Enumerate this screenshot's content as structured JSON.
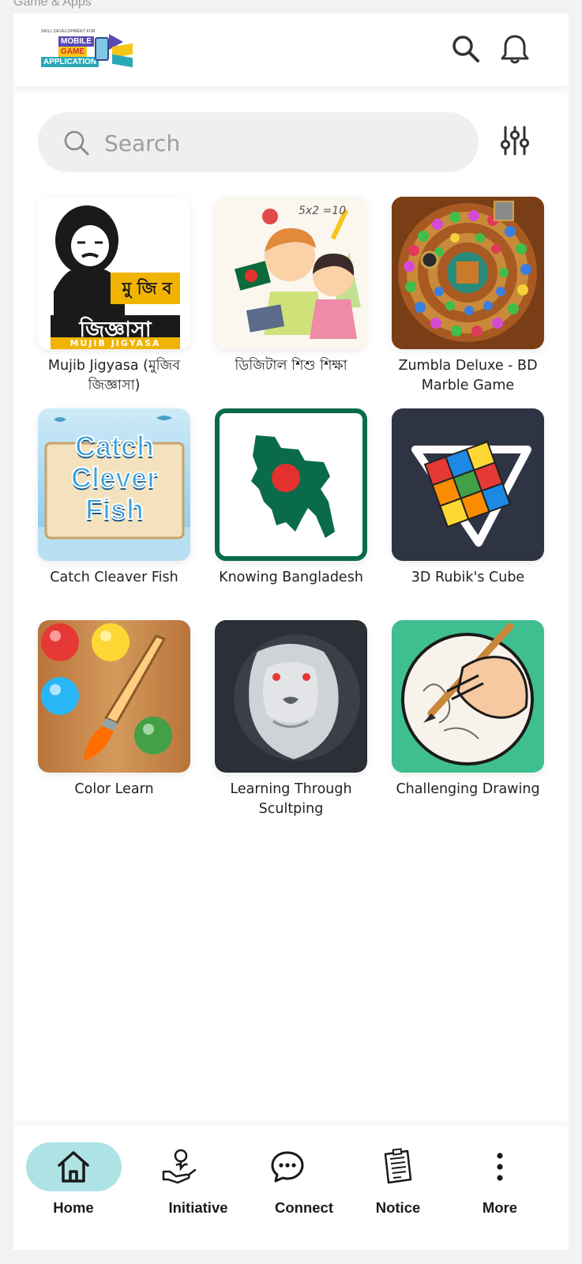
{
  "window": {
    "title": "Game & Apps"
  },
  "header": {
    "logo": {
      "tagline": "SKILL DEVELOPMENT FOR",
      "line1": "MOBILE",
      "line2": "GAME",
      "line3": "APPLICATION"
    },
    "icons": [
      "search-icon",
      "bell-icon"
    ]
  },
  "search": {
    "placeholder": "Search",
    "value": ""
  },
  "apps": [
    {
      "label": "Mujib Jigyasa (মুজিব জিজ্ঞাসা)",
      "art_title": "মু জি ব",
      "art_main": "জিজ্ঞাসা",
      "art_sub": "MUJIB JIGYASA"
    },
    {
      "label": "ডিজিটাল শিশু শিক্ষা",
      "art_math": "5x2 =10"
    },
    {
      "label": "Zumbla Deluxe - BD Marble Game"
    },
    {
      "label": "Catch Cleaver Fish",
      "art_text": "Catch Clever Fish"
    },
    {
      "label": "Knowing Bangladesh"
    },
    {
      "label": "3D Rubik's Cube"
    },
    {
      "label": "Color Learn"
    },
    {
      "label": "Learning Through Scultping"
    },
    {
      "label": "Challenging Drawing"
    }
  ],
  "nav": [
    {
      "label": "Home",
      "icon": "home-icon",
      "active": true
    },
    {
      "label": "Initiative",
      "icon": "initiative-icon",
      "active": false
    },
    {
      "label": "Connect",
      "icon": "chat-icon",
      "active": false
    },
    {
      "label": "Notice",
      "icon": "notice-icon",
      "active": false
    },
    {
      "label": "More",
      "icon": "more-icon",
      "active": false
    }
  ],
  "colors": {
    "nav_active_pill": "#aee3e6",
    "search_bg": "#efefef",
    "icon_color": "#333333"
  }
}
